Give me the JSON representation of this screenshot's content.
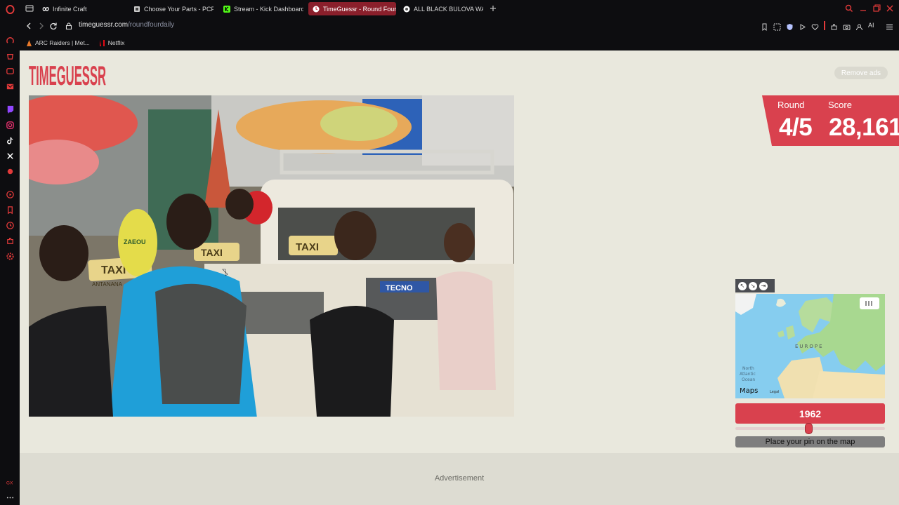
{
  "browser": {
    "tabs": [
      {
        "label": "Infinite Craft",
        "favicon": "infinity-icon"
      },
      {
        "label": "Choose Your Parts - PCPa",
        "favicon": "pcpartpicker-icon"
      },
      {
        "label": "Stream - Kick Dashboard",
        "favicon": "kick-icon"
      },
      {
        "label": "TimeGuessr - Round Four",
        "favicon": "timeguessr-icon"
      },
      {
        "label": "ALL BLACK BULOVA WATC",
        "favicon": "chrome-icon"
      }
    ],
    "url_host": "timeguessr.com",
    "url_path": "/roundfourdaily",
    "bookmarks": [
      {
        "label": "ARC Raiders | Met...",
        "favicon": "arc-icon"
      },
      {
        "label": "Netflix",
        "favicon": "netflix-icon"
      }
    ],
    "toolbar_ai_label": "AI"
  },
  "page": {
    "logo_text": "TIMEGUESSR",
    "remove_ads": "Remove ads",
    "round_label": "Round",
    "round_value": "4/5",
    "score_label": "Score",
    "score_value": "28,161",
    "map": {
      "region_label": "EUROPE",
      "ocean_label_1": "North",
      "ocean_label_2": "Atlantic",
      "ocean_label_3": "Ocean",
      "attribution": "Maps",
      "legal": "Legal"
    },
    "year_value": "1962",
    "slider_fraction": 0.49,
    "pin_button": "Place your pin on the map",
    "advertisement": "Advertisement",
    "photo_signs": {
      "taxi_left": "TAXI",
      "antanana": "ANTANANA",
      "taxi_center": "TAXI",
      "taxi_mid_left": "TAXI",
      "tecno": "TECNO",
      "zaeo": "ZAEOU"
    }
  },
  "colors": {
    "accent": "#d9414e",
    "page_bg": "#e9e8dd",
    "browser_bg": "#0d0d10",
    "active_tab": "#8a1f2b"
  }
}
